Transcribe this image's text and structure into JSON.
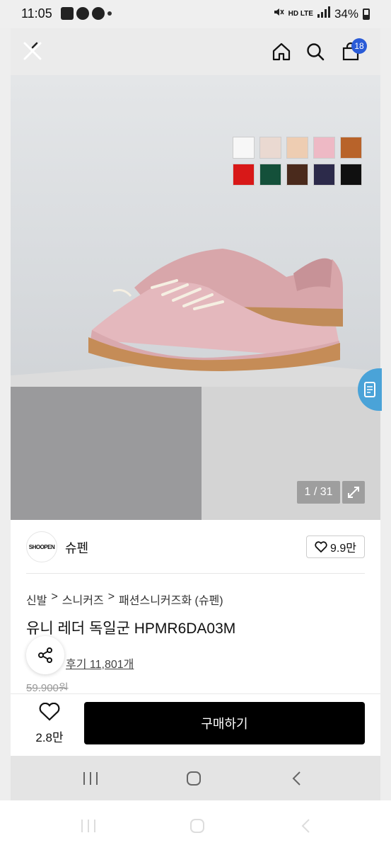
{
  "status_bar": {
    "time": "11:05",
    "network": "HD LTE",
    "battery": "34%"
  },
  "header": {
    "cart_count": "18"
  },
  "hero": {
    "swatches": [
      "#f7f7f7",
      "#ead9d1",
      "#eecdb2",
      "#eeb9c5",
      "#b8632a",
      "#d81818",
      "#14503a",
      "#4a2a1c",
      "#2c2a4a",
      "#101010"
    ],
    "counter": "1 / 31"
  },
  "brand": {
    "logo_text": "SHOOPEN",
    "name": "슈펜",
    "like_count": "9.9만"
  },
  "product": {
    "breadcrumb": [
      "신발",
      "스니커즈",
      "패션스니커즈화 (슈펜)"
    ],
    "title": "유니 레더 독일군 HPMR6DA03M",
    "reviews": "후기 11,801개",
    "original_price": "59,900원"
  },
  "bottom_bar": {
    "wish_count": "2.8만",
    "buy_label": "구매하기"
  }
}
